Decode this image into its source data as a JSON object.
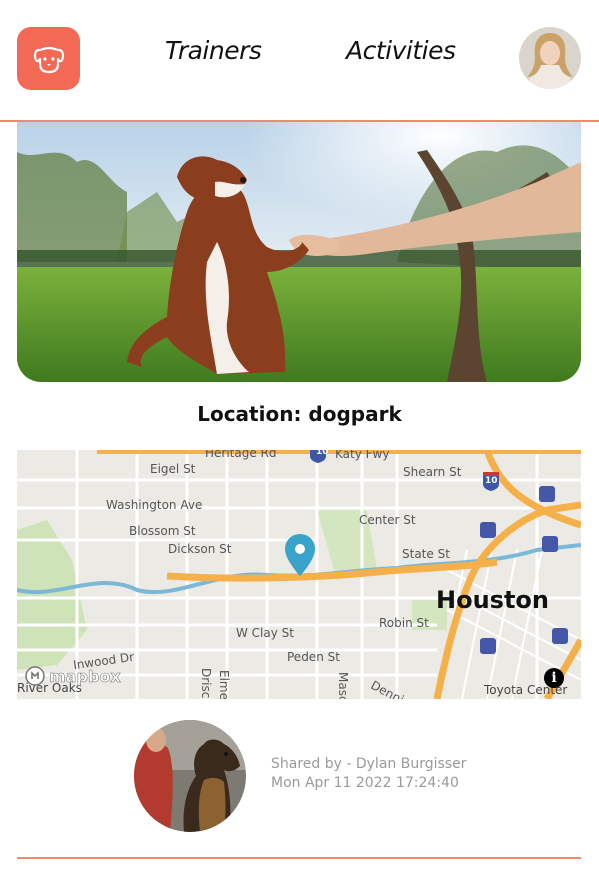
{
  "header": {
    "nav": {
      "trainers": "Trainers",
      "activities": "Activities"
    },
    "logo_icon": "dog-face-icon",
    "avatar_icon": "user-avatar"
  },
  "post": {
    "location_label": "Location: dogpark",
    "shared_by": "Shared by - Dylan Burgisser",
    "timestamp": "Mon Apr 11 2022 17:24:40"
  },
  "map": {
    "city_label": "Houston",
    "streets": [
      "Eigel St",
      "Washington Ave",
      "Blossom St",
      "Dickson St",
      "Center St",
      "State St",
      "Shearn St",
      "W Clay St",
      "Robin St",
      "Peden St",
      "Inwood Dr",
      "Mason",
      "Driscoll",
      "Elmen",
      "Dennis",
      "Katy Fwy",
      "Heritage Rd"
    ],
    "highway_shields": [
      "10",
      "10"
    ],
    "landmarks": [
      "Toyota Center",
      "River Oaks"
    ],
    "attribution": "mapbox",
    "info_icon": "info-icon",
    "pin_icon": "map-pin-icon"
  },
  "colors": {
    "accent": "#f26a55",
    "divider": "#f08a6b",
    "pin": "#3aa3c9",
    "highway": "#f5b04a"
  }
}
